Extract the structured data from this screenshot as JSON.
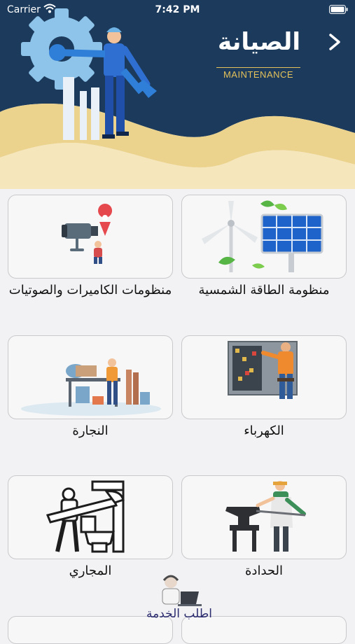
{
  "status_bar": {
    "carrier": "Carrier",
    "time": "7:42 PM"
  },
  "header": {
    "title": "الصيانة",
    "subtitle": "MAINTENANCE"
  },
  "services": [
    {
      "label": "منظومة الطاقة الشمسية",
      "icon": "solar-wind-icon"
    },
    {
      "label": "منظومات الكاميرات والصوتيات",
      "icon": "camera-location-icon"
    },
    {
      "label": "الكهرباء",
      "icon": "electrician-icon"
    },
    {
      "label": "النجارة",
      "icon": "carpenter-icon"
    },
    {
      "label": "الحدادة",
      "icon": "blacksmith-icon"
    },
    {
      "label": "المجاري",
      "icon": "plumber-icon"
    }
  ],
  "request_service": {
    "label": "اطلب الخدمة",
    "icon": "support-agent-icon"
  },
  "colors": {
    "header_navy": "#1b3a5c",
    "accent_gold": "#e8c770",
    "card_border": "#c9c9cc"
  }
}
